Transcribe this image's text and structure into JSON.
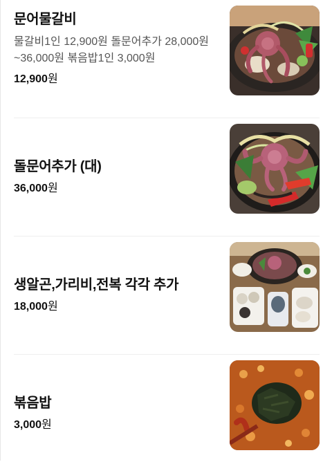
{
  "menu": {
    "items": [
      {
        "name": "문어물갈비",
        "description": "물갈비1인 12,900원 돌문어추가 28,000원~36,000원 볶음밥1인 3,000원",
        "price": "12,900",
        "unit": "원",
        "image_icon": "octopus-galbi-hotpot-photo"
      },
      {
        "name": "돌문어추가 (대)",
        "price": "36,000",
        "unit": "원",
        "image_icon": "octopus-hotpot-photo"
      },
      {
        "name": "생알곤,가리비,전복 각각 추가",
        "price": "18,000",
        "unit": "원",
        "image_icon": "seafood-table-spread-photo"
      },
      {
        "name": "볶음밥",
        "price": "3,000",
        "unit": "원",
        "image_icon": "fried-rice-photo"
      }
    ]
  }
}
